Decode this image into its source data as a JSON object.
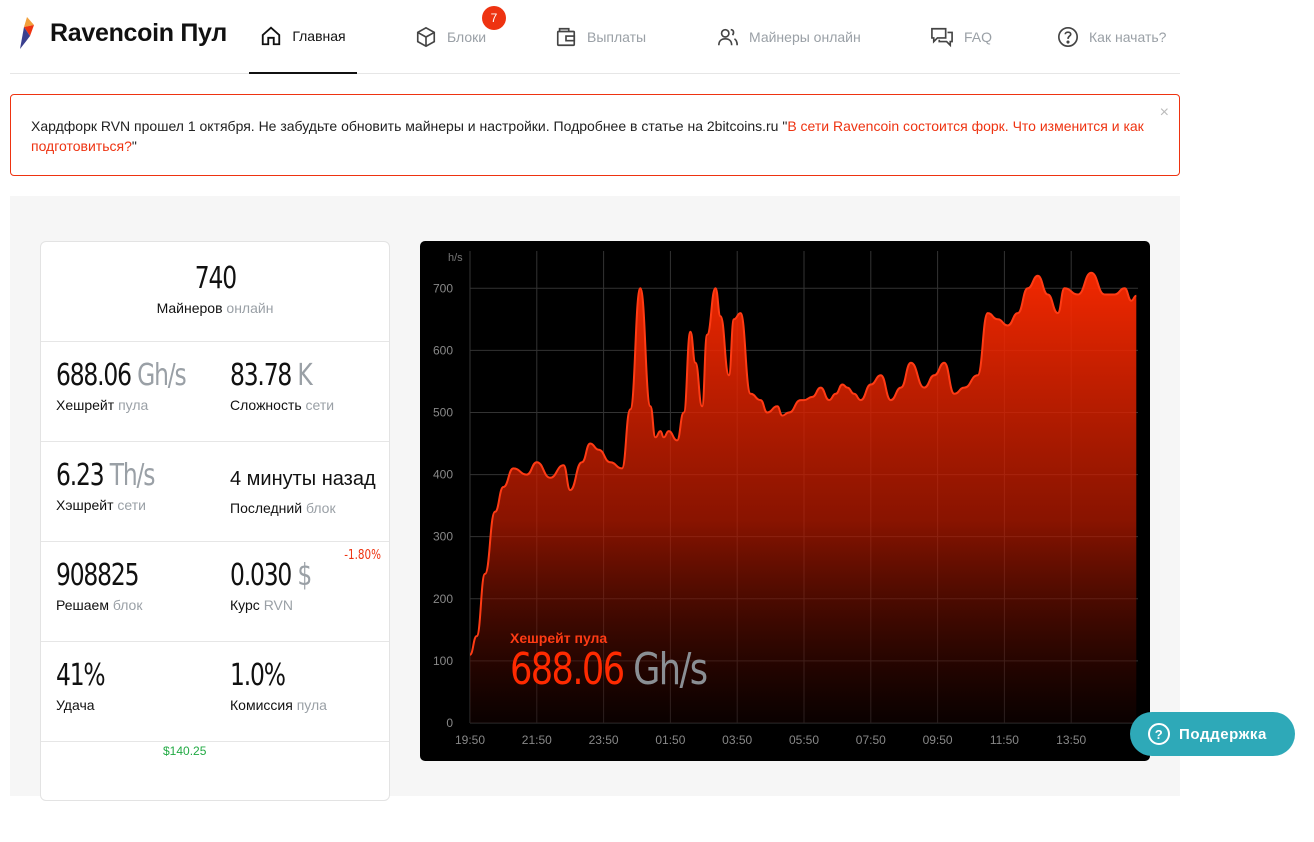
{
  "app": {
    "title": "Ravencoin Пул"
  },
  "nav": [
    {
      "label": "Главная",
      "icon": "home-icon",
      "active": true
    },
    {
      "label": "Блоки",
      "icon": "cube-icon",
      "badge": "7"
    },
    {
      "label": "Выплаты",
      "icon": "wallet-icon"
    },
    {
      "label": "Майнеры онлайн",
      "icon": "users-icon"
    },
    {
      "label": "FAQ",
      "icon": "chat-icon"
    },
    {
      "label": "Как начать?",
      "icon": "help-icon"
    }
  ],
  "alert": {
    "text": "Хардфорк RVN прошел 1 октября. Не забудьте обновить майнеры и настройки. Подробнее в статье на 2bitcoins.ru \"",
    "link": "В сети Ravencoin состоится форк. Что изменится и как подготовиться?",
    "tail": "\"",
    "close": "×"
  },
  "stats": {
    "miners": {
      "value": "740",
      "label": "Майнеров",
      "label_muted": "онлайн"
    },
    "pool_hashrate": {
      "value": "688.06",
      "unit": "Gh/s",
      "label": "Хешрейт",
      "label_muted": "пула"
    },
    "difficulty": {
      "value": "83.78",
      "unit": "K",
      "label": "Сложность",
      "label_muted": "сети"
    },
    "network_hashrate": {
      "value": "6.23",
      "unit": "Th/s",
      "label": "Хэшрейт",
      "label_muted": "сети"
    },
    "last_block": {
      "value": "4 минуты назад",
      "label": "Последний",
      "label_muted": "блок"
    },
    "solving": {
      "value": "908825",
      "label": "Решаем",
      "label_muted": "блок"
    },
    "rate": {
      "value": "0.030",
      "unit": "$",
      "change": "-1.80%",
      "label": "Курс",
      "label_muted": "RVN"
    },
    "luck": {
      "value": "41%",
      "label": "Удача"
    },
    "fee": {
      "value": "1.0%",
      "label": "Комиссия",
      "label_muted": "пула"
    },
    "partial": "$140.25"
  },
  "chart_data": {
    "type": "area",
    "ylabel": "h/s",
    "ylim": [
      0,
      760
    ],
    "y_ticks": [
      0,
      100,
      200,
      300,
      400,
      500,
      600,
      700
    ],
    "x_ticks": [
      "19:50",
      "21:50",
      "23:50",
      "01:50",
      "03:50",
      "05:50",
      "07:50",
      "09:50",
      "11:50",
      "13:50"
    ],
    "overlay_label": "Хешрейт пула",
    "overlay_value": "688.06",
    "overlay_unit": "Gh/s",
    "color": "#ff2a00",
    "series": [
      {
        "x_index": [
          0,
          0.2,
          0.45,
          0.75,
          1.0,
          1.3,
          1.7,
          2.0,
          2.4,
          2.8,
          3.0,
          3.35,
          3.6,
          3.85,
          4.2,
          4.55,
          4.8,
          5.1,
          5.4,
          5.55,
          5.7,
          5.8,
          5.95,
          6.2,
          6.4,
          6.6,
          6.75,
          6.95,
          7.1,
          7.35,
          7.5,
          7.75,
          7.9,
          8.1,
          8.4,
          8.7,
          8.9,
          9.2,
          9.35,
          9.55,
          9.9,
          10.0,
          10.25,
          10.5,
          10.75,
          10.95,
          11.15,
          11.3,
          11.5,
          11.7,
          12.0,
          12.3,
          12.6,
          12.9,
          13.2,
          13.6,
          13.9,
          14.2,
          14.5,
          14.8,
          15.2,
          15.5,
          15.8,
          16.1,
          16.4,
          16.7,
          17.0,
          17.3,
          17.6,
          17.8,
          18.2,
          18.6,
          19.0,
          19.3,
          19.6,
          19.8,
          19.95
        ],
        "values": [
          110,
          140,
          240,
          340,
          380,
          410,
          400,
          420,
          395,
          415,
          375,
          420,
          450,
          440,
          420,
          410,
          505,
          700,
          510,
          460,
          470,
          460,
          470,
          455,
          500,
          630,
          580,
          510,
          625,
          700,
          655,
          560,
          650,
          660,
          530,
          520,
          500,
          510,
          495,
          500,
          520,
          520,
          525,
          540,
          520,
          530,
          545,
          540,
          530,
          520,
          545,
          560,
          520,
          540,
          580,
          540,
          560,
          580,
          530,
          540,
          560,
          660,
          650,
          640,
          660,
          700,
          720,
          690,
          660,
          700,
          690,
          725,
          690,
          690,
          700,
          680,
          688
        ]
      }
    ]
  },
  "support": {
    "label": "Поддержка"
  }
}
